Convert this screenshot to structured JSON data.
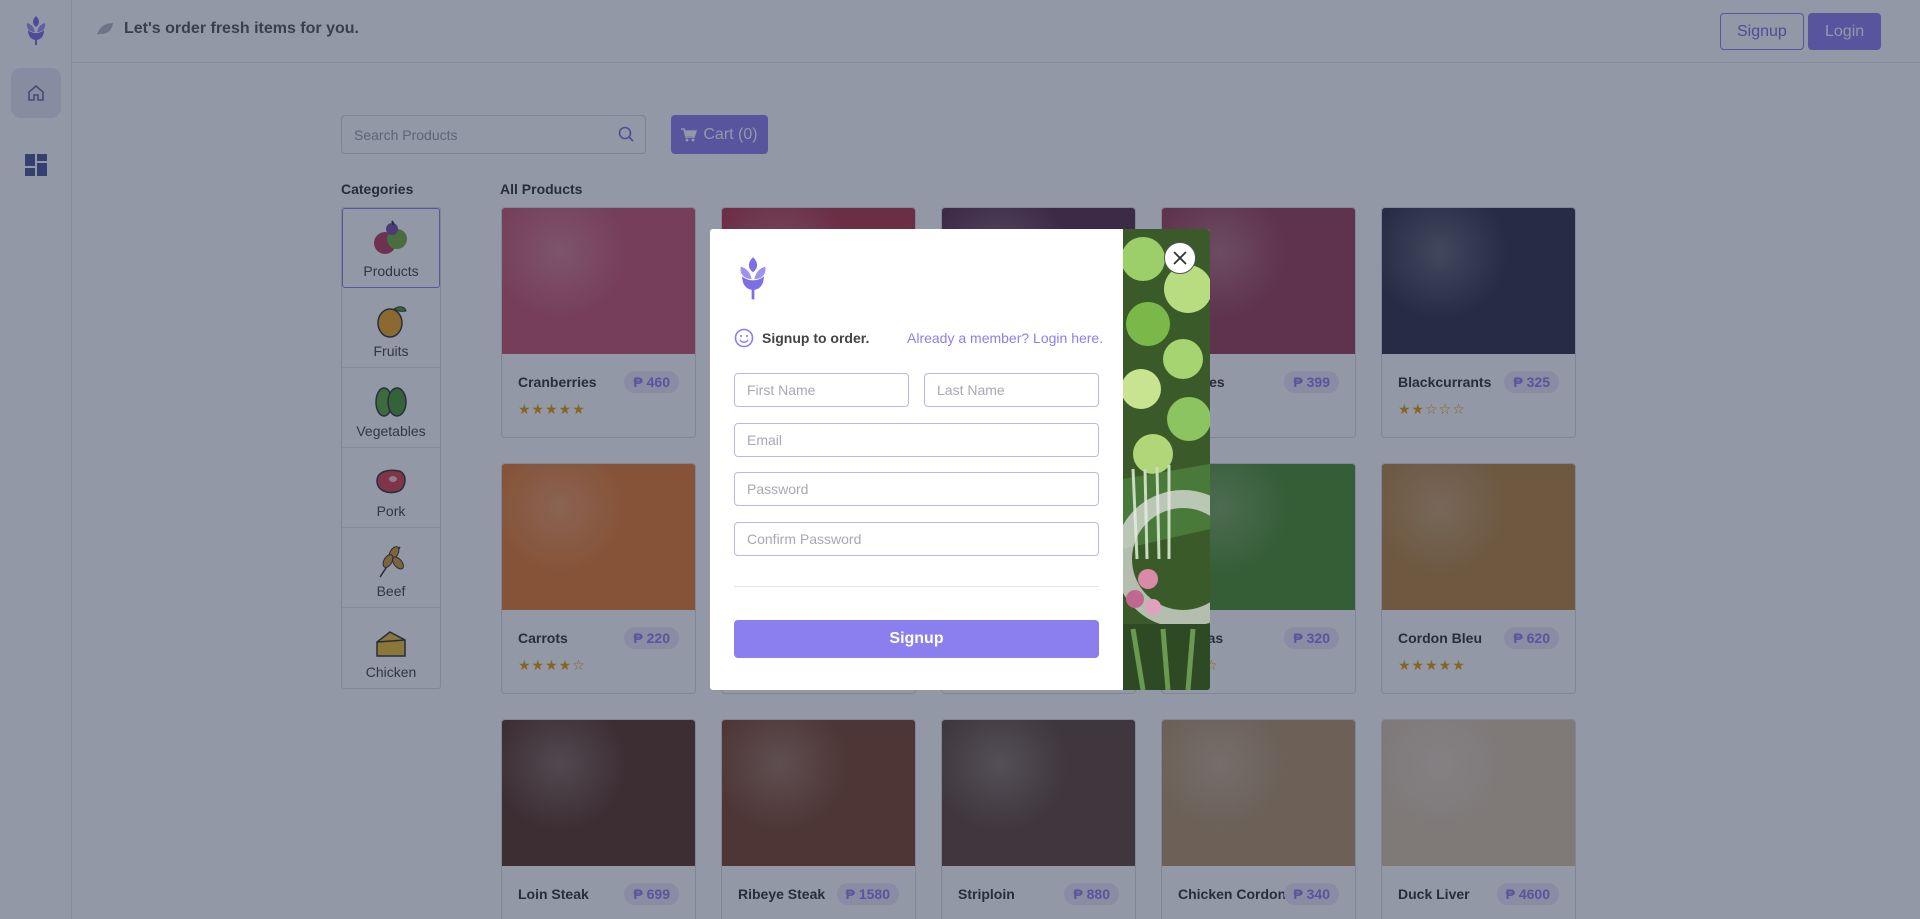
{
  "header": {
    "tagline": "Let's order fresh items for you.",
    "signup_label": "Signup",
    "login_label": "Login"
  },
  "search": {
    "placeholder": "Search Products"
  },
  "cart": {
    "label": "Cart (0)"
  },
  "categories": {
    "title": "Categories",
    "items": [
      {
        "label": "Products",
        "icon": "products-icon"
      },
      {
        "label": "Fruits",
        "icon": "mango-icon"
      },
      {
        "label": "Vegetables",
        "icon": "vegetables-icon"
      },
      {
        "label": "Pork",
        "icon": "pork-icon"
      },
      {
        "label": "Beef",
        "icon": "beef-icon"
      },
      {
        "label": "Chicken",
        "icon": "chicken-icon"
      }
    ]
  },
  "products": {
    "title": "All Products",
    "items": [
      {
        "name": "Cranberries",
        "price": "₱ 460",
        "stars": "★★★★★",
        "rating": 5,
        "color": "#c8546a"
      },
      {
        "name": "",
        "price": "",
        "stars": "",
        "rating": 0,
        "color": "#b33446"
      },
      {
        "name": "",
        "price": "",
        "stars": "",
        "rating": 0,
        "color": "#5b2c48"
      },
      {
        "name": "berries",
        "price": "₱ 399",
        "stars": "☆☆",
        "rating": 0,
        "color": "#9c3c56"
      },
      {
        "name": "Blackcurrants",
        "price": "₱ 325",
        "stars": "★★☆☆☆",
        "rating": 2,
        "color": "#2f3145"
      },
      {
        "name": "Carrots",
        "price": "₱ 220",
        "stars": "★★★★☆",
        "rating": 4,
        "color": "#e77a2c"
      },
      {
        "name": "",
        "price": "",
        "stars": "",
        "rating": 0,
        "color": "#7a4a32"
      },
      {
        "name": "",
        "price": "",
        "stars": "",
        "rating": 0,
        "color": "#6b8a3c"
      },
      {
        "name": "n Peas",
        "price": "₱ 320",
        "stars": "★★☆",
        "rating": 0,
        "color": "#4c8f2a"
      },
      {
        "name": "Cordon Bleu",
        "price": "₱ 620",
        "stars": "★★★★★",
        "rating": 5,
        "color": "#b8843c"
      },
      {
        "name": "Loin Steak",
        "price": "₱ 699",
        "stars": "",
        "rating": 0,
        "color": "#5a3424"
      },
      {
        "name": "Ribeye Steak",
        "price": "₱ 1580",
        "stars": "",
        "rating": 0,
        "color": "#7a4428"
      },
      {
        "name": "Striploin",
        "price": "₱ 880",
        "stars": "",
        "rating": 0,
        "color": "#5e4636"
      },
      {
        "name": "Chicken Cordon",
        "price": "₱ 340",
        "stars": "",
        "rating": 0,
        "color": "#b49468"
      },
      {
        "name": "Duck Liver",
        "price": "₱ 4600",
        "stars": "",
        "rating": 0,
        "color": "#d8c4a8"
      }
    ]
  },
  "modal": {
    "heading": "Signup to order.",
    "login_link": "Already a member? Login here.",
    "first_name_placeholder": "First Name",
    "last_name_placeholder": "Last Name",
    "email_placeholder": "Email",
    "password_placeholder": "Password",
    "confirm_password_placeholder": "Confirm Password",
    "submit_label": "Signup"
  },
  "colors": {
    "accent": "#8b7ff0",
    "star": "#e5a000",
    "overlay": "rgba(30,40,70,0.48)"
  }
}
